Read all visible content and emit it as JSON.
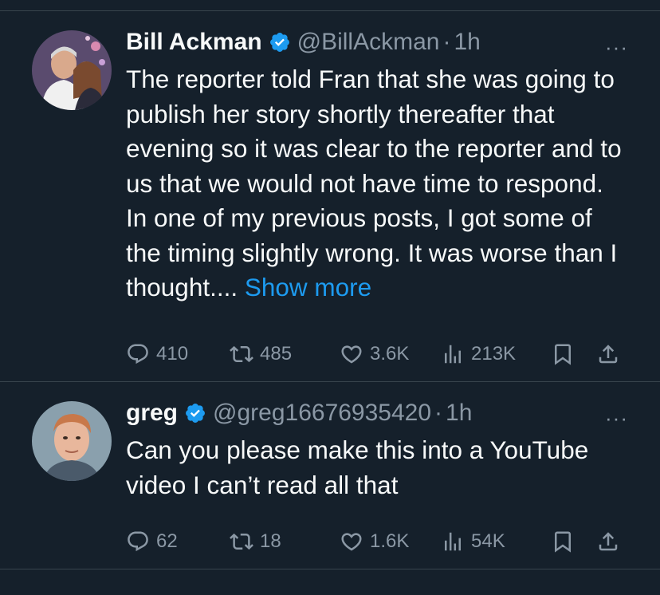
{
  "tweets": [
    {
      "name": "Bill Ackman",
      "handle": "@BillAckman",
      "separator": "·",
      "time": "1h",
      "more": "···",
      "text": "The reporter told Fran that she was going to publish her story shortly thereafter that evening so it was clear to the reporter and to us that we would not have time to respond. In one of my previous posts, I got some of the timing slightly wrong. It was worse than I thought.... ",
      "show_more": "Show more",
      "replies": "410",
      "reposts": "485",
      "likes": "3.6K",
      "views": "213K"
    },
    {
      "name": "greg",
      "handle": "@greg16676935420",
      "separator": "·",
      "time": "1h",
      "more": "···",
      "text": "Can you please make this into a YouTube video I can’t read all that",
      "replies": "62",
      "reposts": "18",
      "likes": "1.6K",
      "views": "54K"
    }
  ],
  "colors": {
    "background": "#15202b",
    "text": "#f7f9f9",
    "muted": "#8b98a5",
    "accent": "#1d9bf0",
    "divider": "#38444d"
  },
  "icons": [
    "verified-badge-icon",
    "more-icon",
    "reply-icon",
    "repost-icon",
    "like-icon",
    "views-icon",
    "bookmark-icon",
    "share-icon"
  ]
}
